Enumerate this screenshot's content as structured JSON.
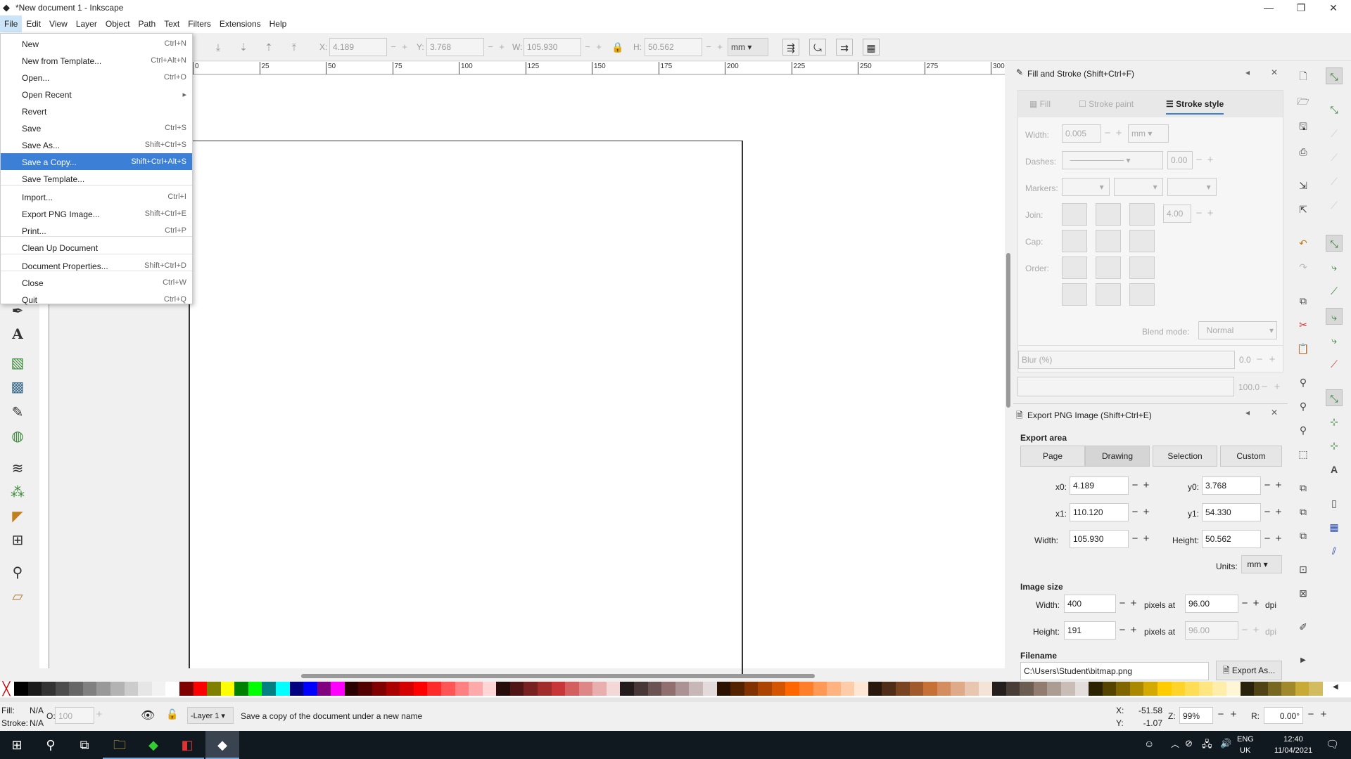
{
  "window": {
    "title": "*New document 1 - Inkscape",
    "min": "—",
    "max": "❐",
    "close": "✕"
  },
  "menubar": [
    "File",
    "Edit",
    "View",
    "Layer",
    "Object",
    "Path",
    "Text",
    "Filters",
    "Extensions",
    "Help"
  ],
  "toolbar": {
    "x_label": "X:",
    "x": "4.189",
    "y_label": "Y:",
    "y": "3.768",
    "w_label": "W:",
    "w": "105.930",
    "h_label": "H:",
    "h": "50.562",
    "unit": "mm"
  },
  "ruler": [
    "0",
    "25",
    "50",
    "75",
    "100",
    "125",
    "150",
    "175",
    "200",
    "225",
    "250",
    "275",
    "300"
  ],
  "filemenu": [
    {
      "label": "New",
      "shortcut": "Ctrl+N"
    },
    {
      "label": "New from Template...",
      "shortcut": "Ctrl+Alt+N"
    },
    {
      "label": "Open...",
      "shortcut": "Ctrl+O"
    },
    {
      "label": "Open Recent",
      "shortcut": "▸"
    },
    {
      "label": "Revert",
      "shortcut": ""
    },
    {
      "label": "Save",
      "shortcut": "Ctrl+S"
    },
    {
      "label": "Save As...",
      "shortcut": "Shift+Ctrl+S"
    },
    {
      "label": "Save a Copy...",
      "shortcut": "Shift+Ctrl+Alt+S"
    },
    {
      "label": "Save Template...",
      "shortcut": ""
    },
    {
      "label": "Import...",
      "shortcut": "Ctrl+I"
    },
    {
      "label": "Export PNG Image...",
      "shortcut": "Shift+Ctrl+E"
    },
    {
      "label": "Print...",
      "shortcut": "Ctrl+P"
    },
    {
      "label": "Clean Up Document",
      "shortcut": ""
    },
    {
      "label": "Document Properties...",
      "shortcut": "Shift+Ctrl+D"
    },
    {
      "label": "Close",
      "shortcut": "Ctrl+W"
    },
    {
      "label": "Quit",
      "shortcut": "Ctrl+Q"
    }
  ],
  "fill_stroke": {
    "title": "Fill and Stroke (Shift+Ctrl+F)",
    "tabs": [
      "Fill",
      "Stroke paint",
      "Stroke style"
    ],
    "width_label": "Width:",
    "width": "0.005",
    "width_unit": "mm",
    "dashes_label": "Dashes:",
    "dash_offset": "0.00",
    "markers_label": "Markers:",
    "join_label": "Join:",
    "miter": "4.00",
    "cap_label": "Cap:",
    "order_label": "Order:",
    "blend_label": "Blend mode:",
    "blend": "Normal",
    "blur_label": "Blur (%)",
    "blur": "0.0",
    "opacity": "100.0"
  },
  "export": {
    "title": "Export PNG Image (Shift+Ctrl+E)",
    "area_label": "Export area",
    "area_buttons": [
      "Page",
      "Drawing",
      "Selection",
      "Custom"
    ],
    "x0_label": "x0:",
    "x0": "4.189",
    "y0_label": "y0:",
    "y0": "3.768",
    "x1_label": "x1:",
    "x1": "110.120",
    "y1_label": "y1:",
    "y1": "54.330",
    "width_label": "Width:",
    "width": "105.930",
    "height_label": "Height:",
    "height": "50.562",
    "units_label": "Units:",
    "units": "mm",
    "size_label": "Image size",
    "img_width_label": "Width:",
    "img_width": "400",
    "img_height_label": "Height:",
    "img_height": "191",
    "pixels_at": "pixels at",
    "dpi1": "96.00",
    "dpi2": "96.00",
    "dpi": "dpi",
    "filename_label": "Filename",
    "filename": "C:\\Users\\Student\\bitmap.png",
    "export_as": "Export As..."
  },
  "status": {
    "fill_label": "Fill:",
    "fill": "N/A",
    "stroke_label": "Stroke:",
    "stroke": "N/A",
    "opacity_label": "O:",
    "opacity": "100",
    "layer": "-Layer 1",
    "message": "Save a copy of the document under a new name",
    "cx_label": "X:",
    "cx": "-51.58",
    "cy_label": "Y:",
    "cy": "-1.07",
    "zoom_label": "Z:",
    "zoom": "99%",
    "rot_label": "R:",
    "rot": "0.00°"
  },
  "taskbar": {
    "lang": "ENG",
    "region": "UK",
    "time": "12:40",
    "date": "11/04/2021"
  },
  "palette": [
    "#000000",
    "#1a1a1a",
    "#333333",
    "#4d4d4d",
    "#666666",
    "#808080",
    "#999999",
    "#b3b3b3",
    "#cccccc",
    "#e6e6e6",
    "#f2f2f2",
    "#ffffff",
    "#800000",
    "#ff0000",
    "#808000",
    "#ffff00",
    "#008000",
    "#00ff00",
    "#008080",
    "#00ffff",
    "#000080",
    "#0000ff",
    "#800080",
    "#ff00ff",
    "#2b0000",
    "#550000",
    "#800000",
    "#aa0000",
    "#d40000",
    "#ff0000",
    "#ff2a2a",
    "#ff5555",
    "#ff8080",
    "#ffaaaa",
    "#ffd5d5",
    "#280b0b",
    "#501616",
    "#782121",
    "#a02c2c",
    "#c83737",
    "#d35f5f",
    "#de8787",
    "#e9afaf",
    "#f4d7d7",
    "#241c1c",
    "#483737",
    "#6c5353",
    "#916f6f",
    "#ac9393",
    "#c8b7b7",
    "#e3dbdb",
    "#2b1100",
    "#552200",
    "#803300",
    "#aa4400",
    "#d45500",
    "#ff6600",
    "#ff7f2a",
    "#ff9955",
    "#ffb380",
    "#ffccaa",
    "#ffe6d5",
    "#28170b",
    "#502d16",
    "#784421",
    "#a05a2c",
    "#c87137",
    "#d38d5f",
    "#deaa87",
    "#e9c6af",
    "#f4e3d7",
    "#241f1c",
    "#483e37",
    "#6c5d53",
    "#917c6f",
    "#ac9d93",
    "#c8beb7",
    "#e3dedb",
    "#2b2200",
    "#554400",
    "#806600",
    "#aa8800",
    "#d4aa00",
    "#ffcc00",
    "#ffd42a",
    "#ffdd55",
    "#ffe680",
    "#ffeeaa",
    "#fff6d5",
    "#28220b",
    "#504416",
    "#786721",
    "#a0892c",
    "#c8ab37",
    "#d3bc5f"
  ]
}
